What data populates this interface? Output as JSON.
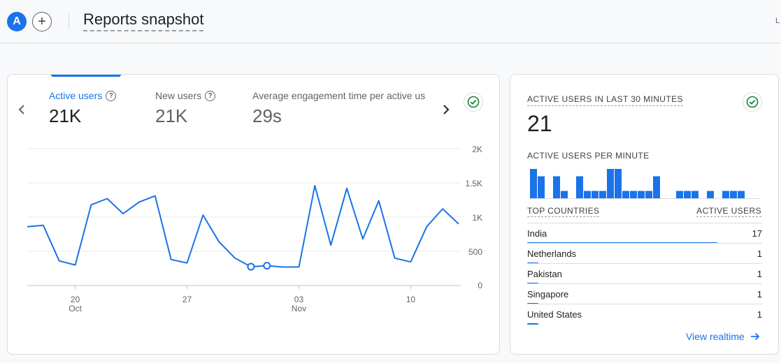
{
  "header": {
    "avatar_letter": "A",
    "add_label": "+",
    "title": "Reports snapshot",
    "truncated_text": "L"
  },
  "metrics": [
    {
      "label": "Active users",
      "value": "21K",
      "active": true
    },
    {
      "label": "New users",
      "value": "21K",
      "active": false
    },
    {
      "label": "Average engagement time per active us",
      "value": "29s",
      "active": false
    }
  ],
  "chart_data": {
    "type": "line",
    "series": [
      {
        "values": [
          860,
          880,
          360,
          300,
          1180,
          1270,
          1050,
          1220,
          1310,
          380,
          330,
          1030,
          640,
          400,
          275,
          290,
          270,
          270,
          1460,
          590,
          1420,
          680,
          1240,
          400,
          345,
          860,
          1120,
          900
        ]
      }
    ],
    "markers_at_index": [
      14,
      15
    ],
    "x_ticks": [
      {
        "day": "20",
        "month": "Oct",
        "index": 3
      },
      {
        "day": "27",
        "month": "",
        "index": 10
      },
      {
        "day": "03",
        "month": "Nov",
        "index": 17
      },
      {
        "day": "10",
        "month": "",
        "index": 24
      }
    ],
    "y_ticks": [
      "0",
      "500",
      "1K",
      "1.5K",
      "2K"
    ],
    "ylim": [
      0,
      2000
    ],
    "color": "#1a73e8",
    "grid": true
  },
  "realtime": {
    "title": "ACTIVE USERS IN LAST 30 MINUTES",
    "value": "21",
    "per_minute_label": "ACTIVE USERS PER MINUTE",
    "per_minute": [
      4,
      3,
      0,
      3,
      1,
      0,
      3,
      1,
      1,
      1,
      4,
      4,
      1,
      1,
      1,
      1,
      3,
      0,
      0,
      1,
      1,
      1,
      0,
      1,
      0,
      1,
      1,
      1,
      0,
      0
    ],
    "countries_header": "TOP COUNTRIES",
    "users_header": "ACTIVE USERS",
    "countries": [
      {
        "name": "India",
        "value": "17",
        "share": 0.81
      },
      {
        "name": "Netherlands",
        "value": "1",
        "share": 0.048
      },
      {
        "name": "Pakistan",
        "value": "1",
        "share": 0.048
      },
      {
        "name": "Singapore",
        "value": "1",
        "share": 0.048
      },
      {
        "name": "United States",
        "value": "1",
        "share": 0.048
      }
    ],
    "view_realtime_label": "View realtime"
  },
  "colors": {
    "accent": "#1a73e8",
    "check": "#188038"
  }
}
